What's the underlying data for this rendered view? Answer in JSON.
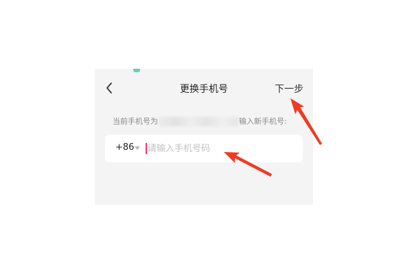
{
  "header": {
    "title": "更换手机号",
    "next_label": "下一步",
    "back_icon": "chevron-left-icon"
  },
  "hint": {
    "prefix": "当前手机号为",
    "suffix": "输入新手机号:"
  },
  "phone_input": {
    "country_code": "+86",
    "value": "",
    "placeholder": "请输入手机号码"
  },
  "colors": {
    "accent": "#ff2b6a",
    "annotation_arrow": "#f03a22"
  }
}
